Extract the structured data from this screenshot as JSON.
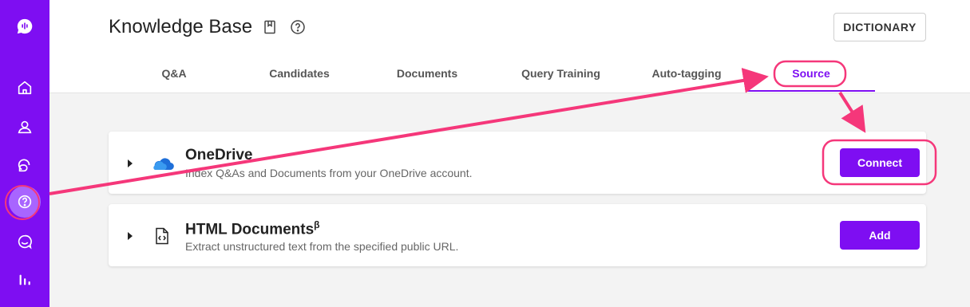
{
  "header": {
    "title": "Knowledge Base",
    "dictionary_label": "DICTIONARY"
  },
  "tabs": [
    {
      "label": "Q&A"
    },
    {
      "label": "Candidates"
    },
    {
      "label": "Documents"
    },
    {
      "label": "Query Training"
    },
    {
      "label": "Auto-tagging"
    },
    {
      "label": "Source",
      "active": true
    }
  ],
  "sources": [
    {
      "title": "OneDrive",
      "description": "Index Q&As and Documents from your OneDrive account.",
      "action_label": "Connect",
      "icon": "onedrive-cloud-icon"
    },
    {
      "title": "HTML Documents",
      "superscript": "β",
      "description": "Extract unstructured text from the specified public URL.",
      "action_label": "Add",
      "icon": "html-document-icon"
    }
  ],
  "sidebar": {
    "items": [
      "logo-icon",
      "home-icon",
      "contacts-icon",
      "conversations-icon",
      "knowledge-base-icon",
      "chat-icon",
      "analytics-icon"
    ],
    "active": "knowledge-base-icon"
  },
  "colors": {
    "accent": "#7e0ef2",
    "annotation": "#f5377a"
  }
}
